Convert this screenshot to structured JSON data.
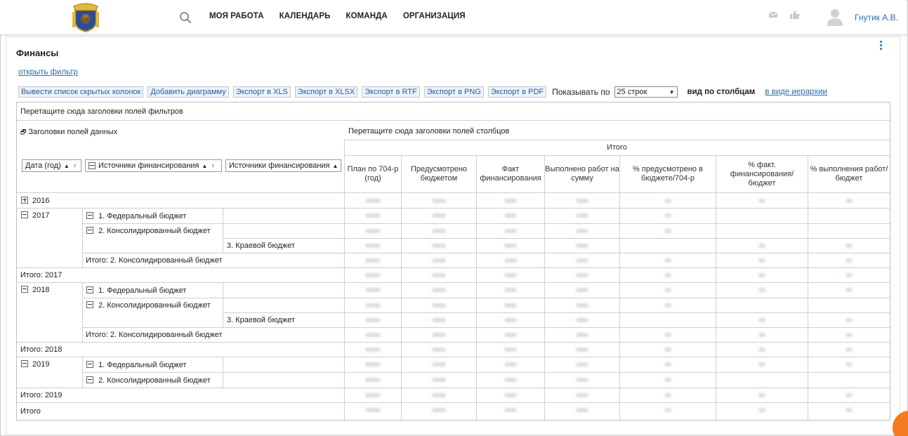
{
  "header": {
    "nav": [
      "МОЯ РАБОТА",
      "КАЛЕНДАРЬ",
      "КОМАНДА",
      "ОРГАНИЗАЦИЯ"
    ],
    "user_name": "Гнутик А.В.",
    "icons": [
      "coat-of-arms-logo",
      "search-icon",
      "mail-icon",
      "thumbs-up-icon",
      "user-avatar-icon"
    ]
  },
  "page": {
    "title": "Финансы",
    "open_filter": "открыть фильтр"
  },
  "toolbar": {
    "buttons": [
      "Вывести список скрытых колонок",
      "Добавить диаграмму",
      "Экспорт в XLS",
      "Экспорт в XLSX",
      "Экспорт в RTF",
      "Экспорт в PNG",
      "Экспорт в PDF"
    ],
    "show_by_label": "Показывать по",
    "rows_value": "25 строк",
    "view_columns": "вид по столбцам",
    "view_hierarchy": "в виде иерархии"
  },
  "pivot": {
    "filter_drop": "Перетащите сюда заголовки полей фильтров",
    "data_fields": "Заголовки полей данных",
    "column_drop": "Перетащите сюда заголовки полей столбцов",
    "total_header": "Итого",
    "row_fields": [
      "Дата (год)",
      "Источники финансирования",
      "Источники финансирования"
    ],
    "columns": [
      "План по 704-р (год)",
      "Предусмотрено бюджетом",
      "Факт финансирования",
      "Выполнено работ на сумму",
      "% предусмотрено в бюджете/704-р",
      "% факт. финансирования/ бюджет",
      "% выполнения работ/бюджет"
    ],
    "rows": [
      {
        "y2016": "2016"
      },
      {
        "y2017": "2017",
        "fed": "1. Федеральный бюджет",
        "cons": "2. Консолидированный бюджет",
        "kr": "3. Краевой бюджет",
        "sub": "Итого: 2. Консолидированный бюджет",
        "total": "Итого: 2017"
      },
      {
        "y2018": "2018",
        "fed": "1. Федеральный бюджет",
        "cons": "2. Консолидированный бюджет",
        "kr": "3. Краевой бюджет",
        "sub": "Итого: 2. Консолидированный бюджет",
        "total": "Итого: 2018"
      },
      {
        "y2019": "2019",
        "fed": "1. Федеральный бюджет",
        "cons": "2. Консолидированный бюджет",
        "total": "Итого: 2019"
      }
    ],
    "grand_total": "Итого"
  }
}
